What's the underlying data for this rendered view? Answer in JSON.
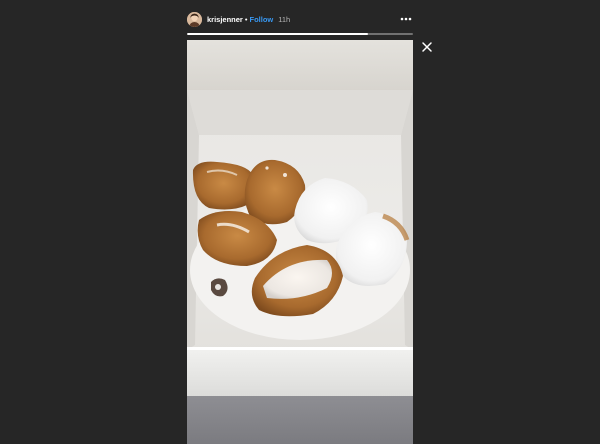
{
  "story": {
    "username": "krisjenner",
    "separator": "•",
    "follow_label": "Follow",
    "timestamp": "11h",
    "progress": 0.8
  },
  "icons": {
    "more": "more-horizontal-icon",
    "close": "close-icon"
  },
  "colors": {
    "background": "#262626",
    "follow": "#3897f0"
  }
}
